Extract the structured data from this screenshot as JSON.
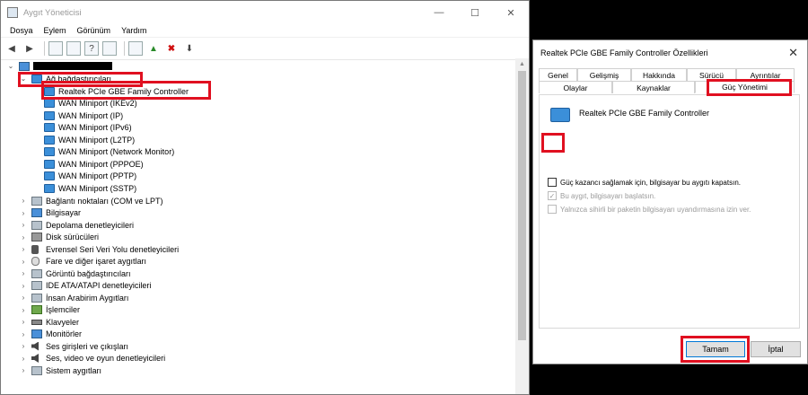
{
  "devmgr": {
    "title": "Aygıt Yöneticisi",
    "menu": [
      "Dosya",
      "Eylem",
      "Görünüm",
      "Yardım"
    ],
    "tree": {
      "network_category": "Ağ bağdaştırıcıları",
      "network_adapters": [
        "Realtek PCIe GBE Family Controller",
        "WAN Miniport (IKEv2)",
        "WAN Miniport (IP)",
        "WAN Miniport (IPv6)",
        "WAN Miniport (L2TP)",
        "WAN Miniport (Network Monitor)",
        "WAN Miniport (PPPOE)",
        "WAN Miniport (PPTP)",
        "WAN Miniport (SSTP)"
      ],
      "categories": [
        "Bağlantı noktaları (COM ve LPT)",
        "Bilgisayar",
        "Depolama denetleyicileri",
        "Disk sürücüleri",
        "Evrensel Seri Veri Yolu denetleyicileri",
        "Fare ve diğer işaret aygıtları",
        "Görüntü bağdaştırıcıları",
        "IDE ATA/ATAPI denetleyicileri",
        "İnsan Arabirim Aygıtları",
        "İşlemciler",
        "Klavyeler",
        "Monitörler",
        "Ses girişleri ve çıkışları",
        "Ses, video ve oyun denetleyicileri",
        "Sistem aygıtları"
      ]
    }
  },
  "props": {
    "title": "Realtek PCIe GBE Family Controller Özellikleri",
    "tabs_row1": [
      "Genel",
      "Gelişmiş",
      "Hakkında",
      "Sürücü",
      "Ayrıntılar"
    ],
    "tabs_row2": [
      "Olaylar",
      "Kaynaklar",
      "Güç Yönetimi"
    ],
    "device_name": "Realtek PCIe GBE Family Controller",
    "options": [
      "Güç kazancı sağlamak için, bilgisayar bu aygıtı kapatsın.",
      "Bu aygıt, bilgisayarı başlatsın.",
      "Yalnızca sihirli bir paketin bilgisayarı uyandırmasına izin ver."
    ],
    "ok_label": "Tamam",
    "cancel_label": "İptal"
  },
  "colors": {
    "highlight": "#e01020",
    "accent": "#0078d7"
  }
}
